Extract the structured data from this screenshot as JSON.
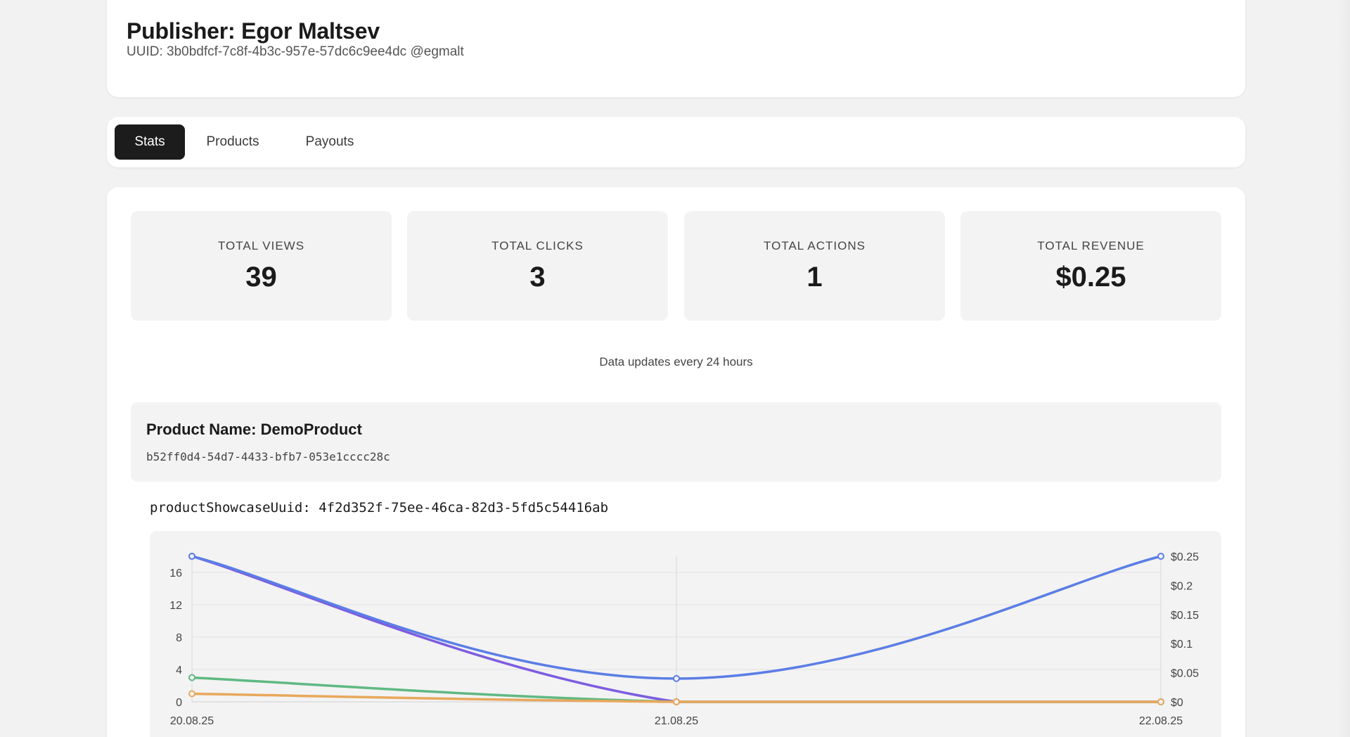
{
  "header": {
    "title": "Publisher: Egor Maltsev",
    "uuid_line": "UUID: 3b0bdfcf-7c8f-4b3c-957e-57dc6c9ee4dc @egmalt"
  },
  "tabs": [
    {
      "label": "Stats",
      "active": true
    },
    {
      "label": "Products",
      "active": false
    },
    {
      "label": "Payouts",
      "active": false
    }
  ],
  "stats": [
    {
      "label": "TOTAL VIEWS",
      "value": "39"
    },
    {
      "label": "TOTAL CLICKS",
      "value": "3"
    },
    {
      "label": "TOTAL ACTIONS",
      "value": "1"
    },
    {
      "label": "TOTAL REVENUE",
      "value": "$0.25"
    }
  ],
  "note": "Data updates every 24 hours",
  "product": {
    "name_line": "Product Name: DemoProduct",
    "uuid": "b52ff0d4-54d7-4433-bfb7-053e1cccc28c"
  },
  "showcase_line": "productShowcaseUuid: 4f2d352f-75ee-46ca-82d3-5fd5c54416ab",
  "colors": {
    "blue": "#5b7ee5",
    "purple": "#7d5ce0",
    "green": "#5fb982",
    "orange": "#e8a85c",
    "active_tab": "#1c1c1c"
  },
  "chart_data": {
    "type": "line",
    "x": [
      "20.08.25",
      "21.08.25",
      "22.08.25"
    ],
    "y_left_ticks": [
      "0",
      "4",
      "8",
      "12",
      "16"
    ],
    "y_left_range": [
      0,
      18
    ],
    "y_right_ticks": [
      "$0",
      "$0.05",
      "$0.1",
      "$0.15",
      "$0.2",
      "$0.25"
    ],
    "y_right_range": [
      0,
      0.25
    ],
    "grid": true,
    "series": [
      {
        "axis": "left",
        "color": "#7d5ce0",
        "values": [
          18,
          0,
          0
        ]
      },
      {
        "axis": "left",
        "color": "#5fb982",
        "values": [
          3,
          0,
          0
        ]
      },
      {
        "axis": "left",
        "color": "#e8a85c",
        "values": [
          1,
          0,
          0
        ]
      },
      {
        "axis": "right",
        "color": "#5b7ee5",
        "values": [
          0.25,
          0.04,
          0.25
        ]
      }
    ]
  }
}
